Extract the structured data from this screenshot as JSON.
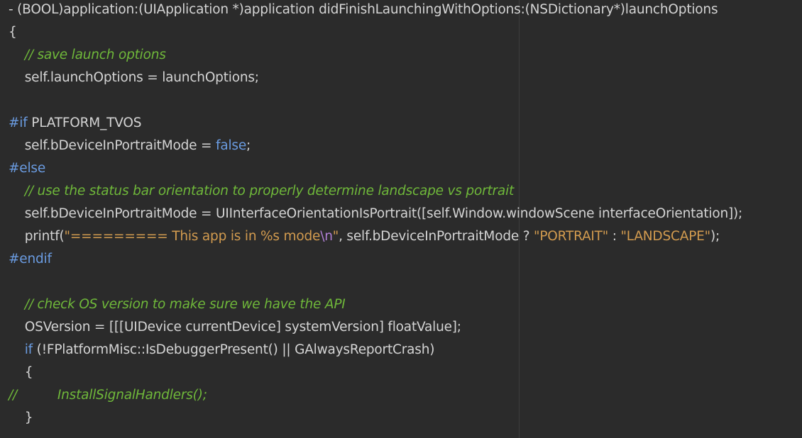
{
  "editor": {
    "background": "#2b2b2b",
    "colors": {
      "plain": "#d4d4d4",
      "comment": "#6fb83a",
      "keyword": "#6a9be0",
      "string": "#d29b4f",
      "escape": "#b07fd4"
    },
    "lines": [
      {
        "tokens": [
          {
            "t": "plain",
            "v": "- (BOOL)application:(UIApplication *)application didFinishLaunchingWithOptions:(NSDictionary*)launchOptions"
          }
        ]
      },
      {
        "tokens": [
          {
            "t": "plain",
            "v": "{"
          }
        ]
      },
      {
        "tokens": [
          {
            "t": "comment",
            "v": "    // save launch options"
          }
        ]
      },
      {
        "tokens": [
          {
            "t": "plain",
            "v": "    self.launchOptions = launchOptions;"
          }
        ]
      },
      {
        "tokens": []
      },
      {
        "tokens": [
          {
            "t": "preproc",
            "v": "#if"
          },
          {
            "t": "plain",
            "v": " PLATFORM_TVOS"
          }
        ]
      },
      {
        "tokens": [
          {
            "t": "plain",
            "v": "    self.bDeviceInPortraitMode = "
          },
          {
            "t": "keyword",
            "v": "false"
          },
          {
            "t": "plain",
            "v": ";"
          }
        ]
      },
      {
        "tokens": [
          {
            "t": "preproc",
            "v": "#else"
          }
        ]
      },
      {
        "tokens": [
          {
            "t": "comment",
            "v": "    // use the status bar orientation to properly determine landscape vs portrait"
          }
        ]
      },
      {
        "tokens": [
          {
            "t": "plain",
            "v": "    self.bDeviceInPortraitMode = UIInterfaceOrientationIsPortrait([self.Window.windowScene interfaceOrientation]);"
          }
        ]
      },
      {
        "tokens": [
          {
            "t": "plain",
            "v": "    printf("
          },
          {
            "t": "string",
            "v": "\"========= This app is in %s mode"
          },
          {
            "t": "escape",
            "v": "\\n"
          },
          {
            "t": "string",
            "v": "\""
          },
          {
            "t": "plain",
            "v": ", self.bDeviceInPortraitMode ? "
          },
          {
            "t": "string",
            "v": "\"PORTRAIT\""
          },
          {
            "t": "plain",
            "v": " : "
          },
          {
            "t": "string",
            "v": "\"LANDSCAPE\""
          },
          {
            "t": "plain",
            "v": ");"
          }
        ]
      },
      {
        "tokens": [
          {
            "t": "preproc",
            "v": "#endif"
          }
        ]
      },
      {
        "tokens": []
      },
      {
        "tokens": [
          {
            "t": "comment",
            "v": "    // check OS version to make sure we have the API"
          }
        ]
      },
      {
        "tokens": [
          {
            "t": "plain",
            "v": "    OSVersion = [[[UIDevice currentDevice] systemVersion] floatValue];"
          }
        ]
      },
      {
        "tokens": [
          {
            "t": "plain",
            "v": "    "
          },
          {
            "t": "keyword",
            "v": "if"
          },
          {
            "t": "plain",
            "v": " (!FPlatformMisc::IsDebuggerPresent() || GAlwaysReportCrash)"
          }
        ]
      },
      {
        "tokens": [
          {
            "t": "plain",
            "v": "    {"
          }
        ]
      },
      {
        "tokens": [
          {
            "t": "comment",
            "v": "//          InstallSignalHandlers();"
          }
        ]
      },
      {
        "tokens": [
          {
            "t": "plain",
            "v": "    }"
          }
        ]
      }
    ]
  }
}
